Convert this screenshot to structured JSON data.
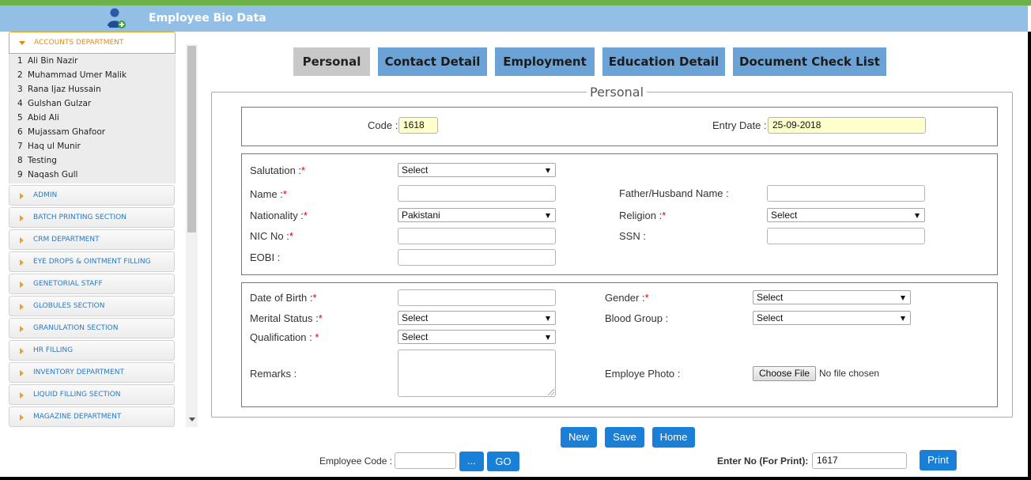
{
  "header": {
    "title": "Employee Bio Data",
    "logo_icon": "user-add-icon"
  },
  "sidebar": {
    "open_department": "ACCOUNTS DEPARTMENT",
    "employees": [
      {
        "num": "1",
        "name": "Ali Bin Nazir"
      },
      {
        "num": "2",
        "name": "Muhammad Umer Malik"
      },
      {
        "num": "3",
        "name": "Rana Ijaz Hussain"
      },
      {
        "num": "4",
        "name": "Gulshan Gulzar"
      },
      {
        "num": "5",
        "name": "Abid Ali"
      },
      {
        "num": "6",
        "name": "Mujassam Ghafoor"
      },
      {
        "num": "7",
        "name": "Haq ul Munir"
      },
      {
        "num": "8",
        "name": "Testing"
      },
      {
        "num": "9",
        "name": "Naqash Gull"
      }
    ],
    "departments": [
      "ADMIN",
      "BATCH PRINTING SECTION",
      "CRM DEPARTMENT",
      "EYE DROPS & OINTMENT FILLING",
      "GENETORIAL STAFF",
      "GLOBULES SECTION",
      "GRANULATION SECTION",
      "HR FILLING",
      "INVENTORY DEPARTMENT",
      "LIQUID FILLING SECTION",
      "MAGAZINE DEPARTMENT"
    ]
  },
  "tabs": [
    "Personal",
    "Contact Detail",
    "Employment",
    "Education Detail",
    "Document Check List"
  ],
  "active_tab": "Personal",
  "form": {
    "legend": "Personal",
    "code_label": "Code :",
    "code_value": "1618",
    "entry_date_label": "Entry Date :",
    "entry_date_value": "25-09-2018",
    "salutation_label": "Salutation :",
    "salutation_value": "Select",
    "name_label": "Name :",
    "father_label": "Father/Husband Name :",
    "nationality_label": "Nationality :",
    "nationality_value": "Pakistani",
    "religion_label": "Religion :",
    "religion_value": "Select",
    "nic_label": "NIC No :",
    "ssn_label": "SSN :",
    "eobi_label": "EOBI :",
    "dob_label": "Date of Birth :",
    "gender_label": "Gender :",
    "gender_value": "Select",
    "marital_label": "Merital Status :",
    "marital_value": "Select",
    "blood_label": "Blood Group :",
    "blood_value": "Select",
    "qualification_label": "Qualification : ",
    "qualification_value": "Select",
    "remarks_label": "Remarks :",
    "photo_label": "Employe Photo :",
    "choose_file_label": "Choose File",
    "no_file_text": "No file chosen",
    "required_mark": "*"
  },
  "actions": {
    "new": "New",
    "save": "Save",
    "home": "Home"
  },
  "footer": {
    "employee_code_label": "Employee Code :",
    "dots_label": "...",
    "go_label": "GO",
    "enter_no_label": "Enter No (For Print):",
    "enter_no_value": "1617",
    "print_label": "Print"
  },
  "colors": {
    "header_bg": "#93bfe6",
    "accent_green": "#6db14a",
    "tab_bg": "#6ca3d6",
    "button_blue": "#1a7fd6"
  }
}
